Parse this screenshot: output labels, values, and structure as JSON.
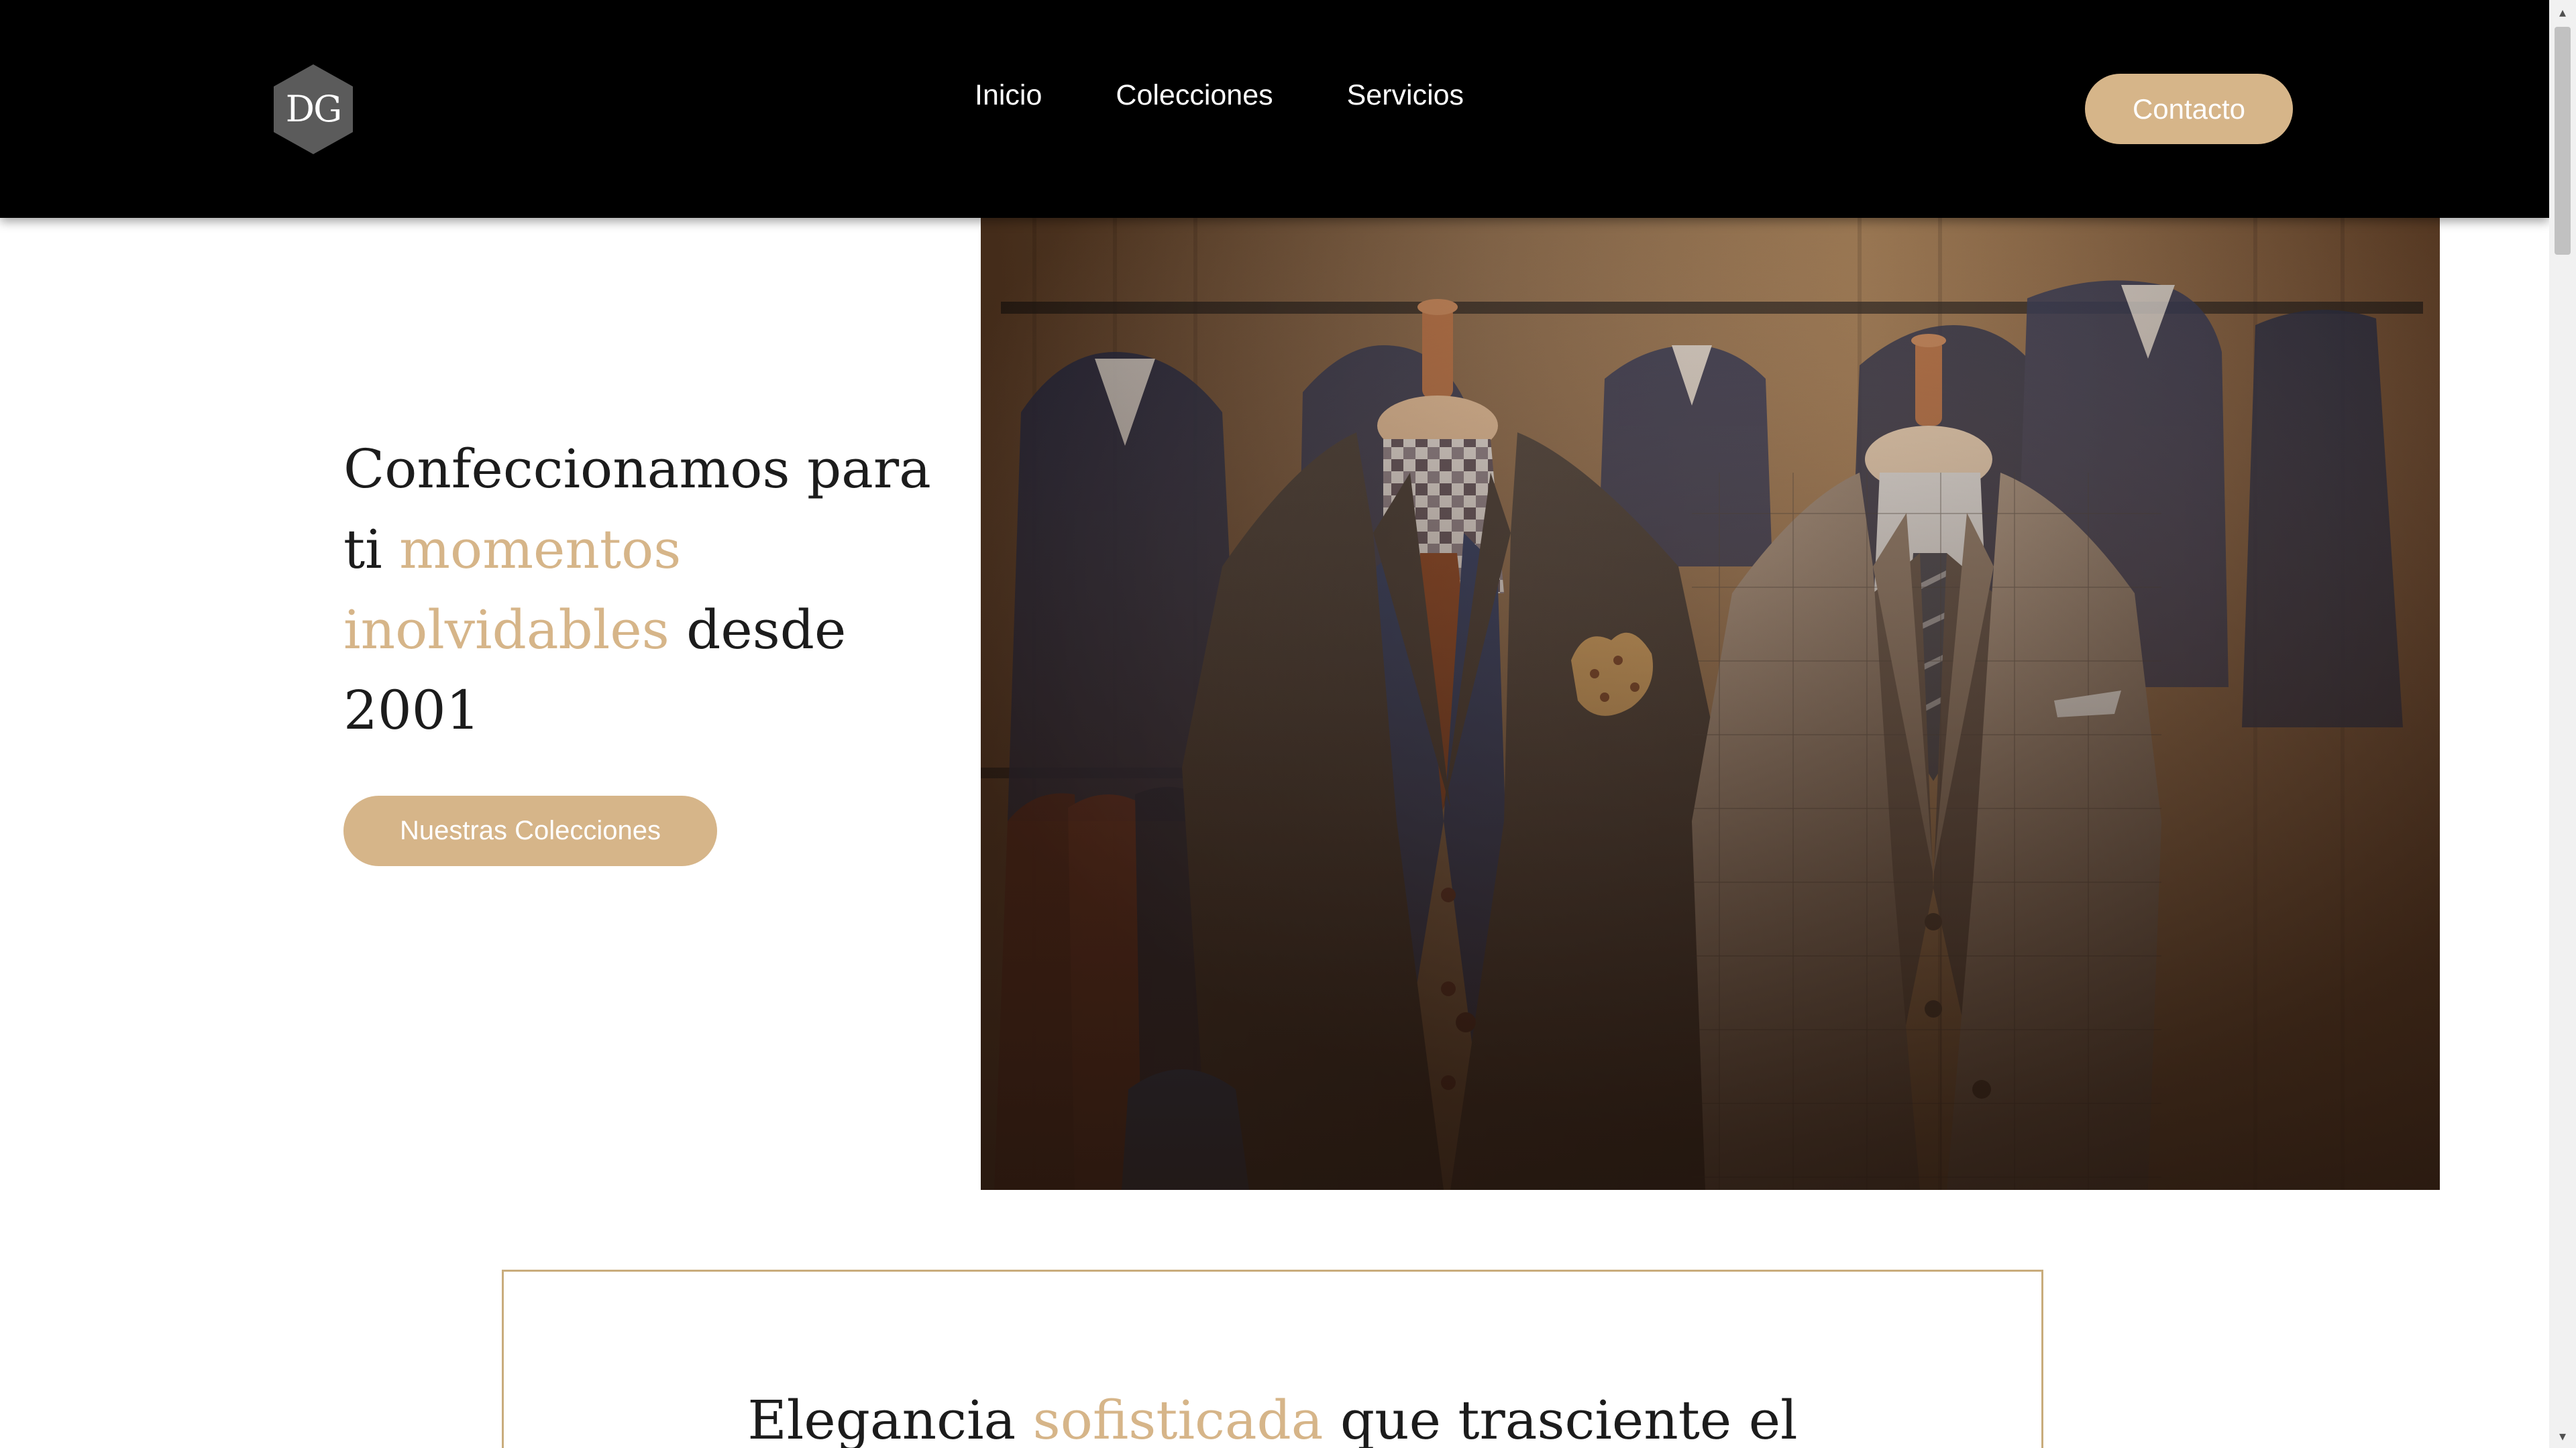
{
  "brand": {
    "logo_text": "DG"
  },
  "nav": {
    "items": [
      {
        "label": "Inicio"
      },
      {
        "label": "Colecciones"
      },
      {
        "label": "Servicios"
      }
    ]
  },
  "header": {
    "contact_label": "Contacto"
  },
  "hero": {
    "title_part1": "Confeccionamos para ti ",
    "title_accent": "momentos inolvidables",
    "title_part2": " desde 2001",
    "button_label": "Nuestras Colecciones"
  },
  "feature": {
    "title_part1": "Elegancia ",
    "title_accent": "sofisticada",
    "title_part2": " que trasciente el"
  },
  "colors": {
    "accent": "#d6b589",
    "header_bg": "#000000",
    "text": "#1c1c1c",
    "border": "#c9ac7c"
  },
  "icons": {
    "scroll_up": "scroll-up-arrow-icon",
    "scroll_down": "scroll-down-arrow-icon"
  }
}
